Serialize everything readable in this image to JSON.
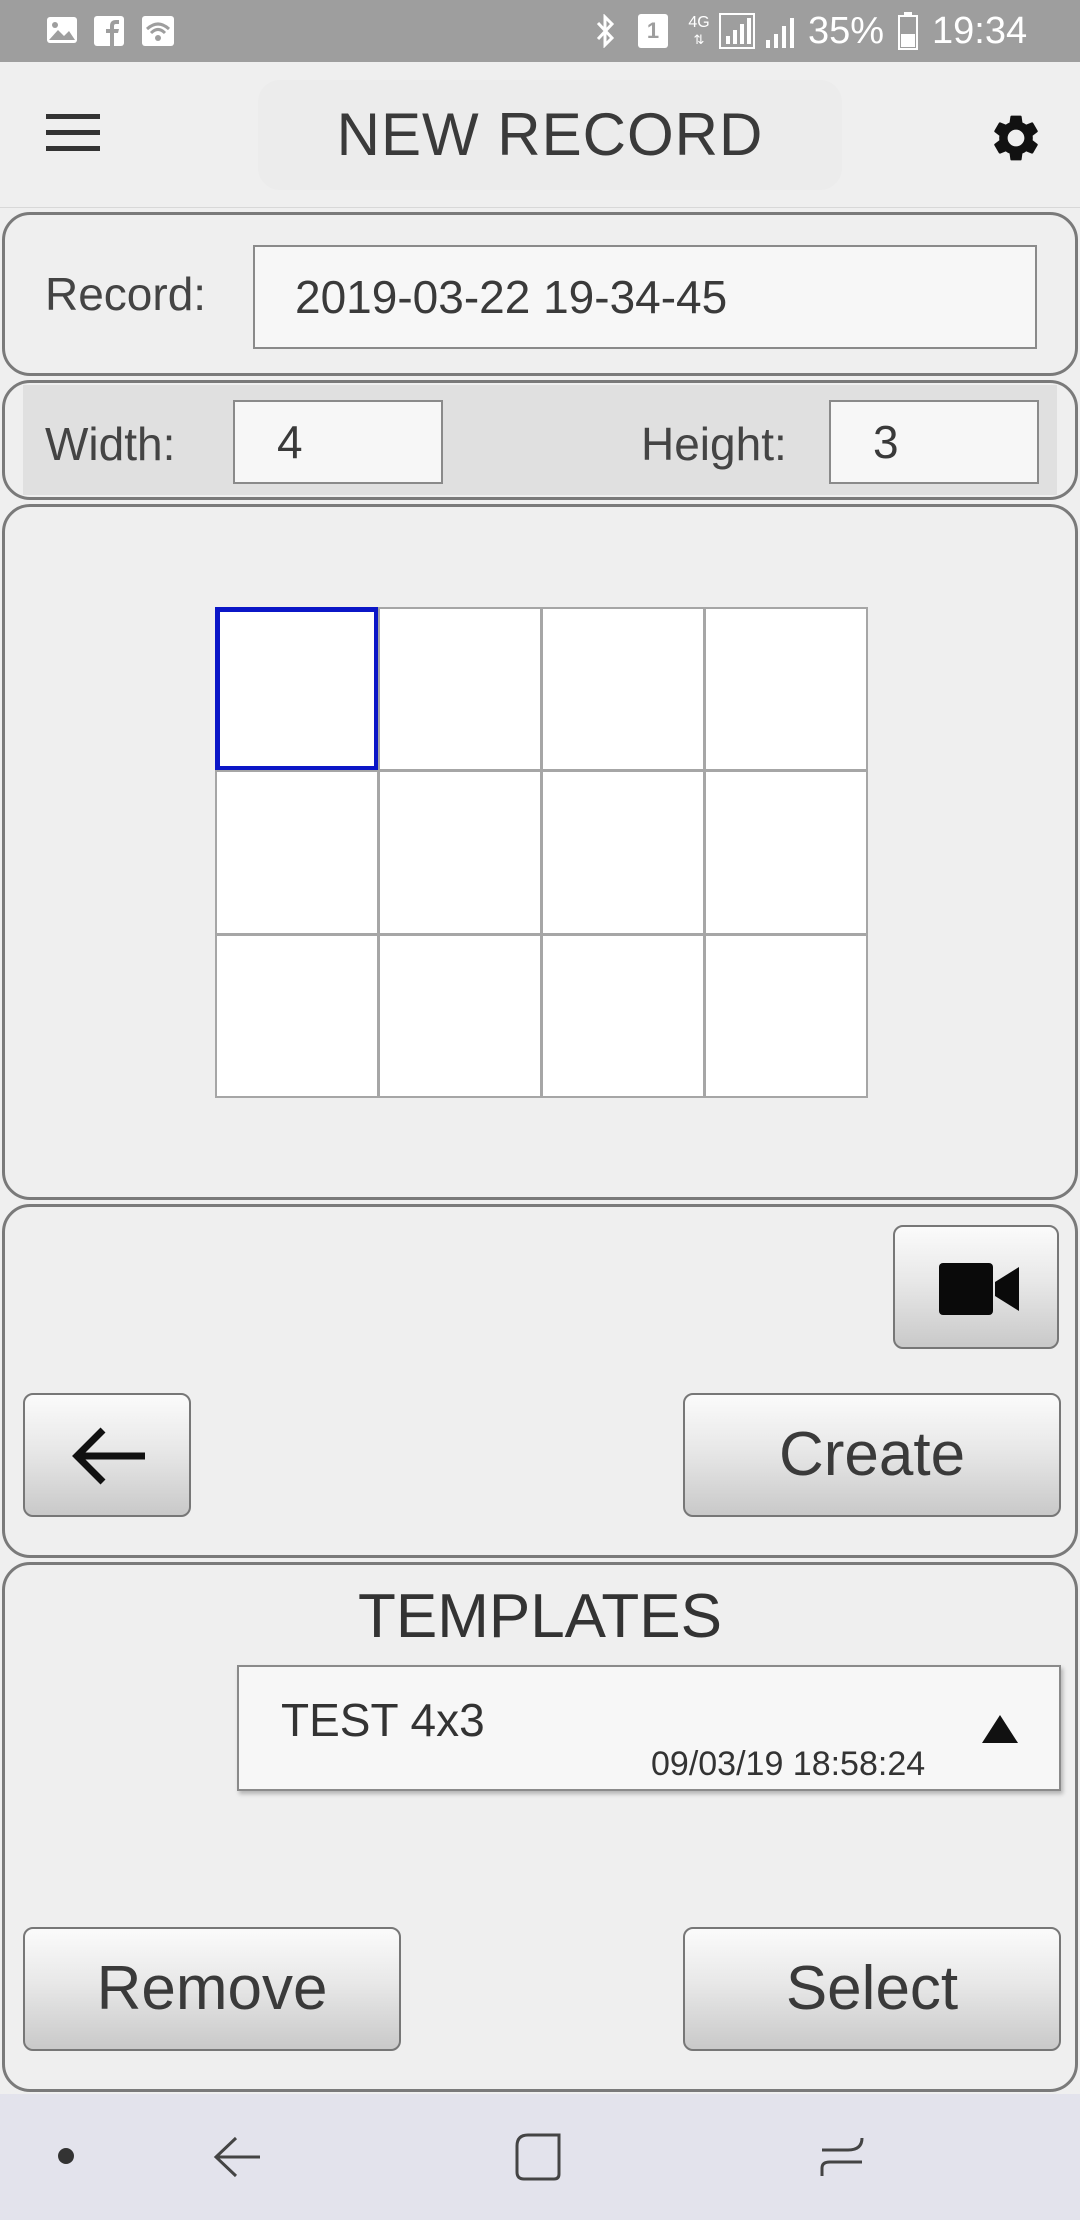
{
  "status_bar": {
    "battery_percent": "35%",
    "time": "19:34",
    "network": "4G",
    "sim_slot": "1",
    "icons": [
      "gallery-icon",
      "facebook-icon",
      "wifi-icon",
      "bluetooth-icon",
      "sim-icon",
      "network-icon",
      "signal-icon",
      "signal-icon-2",
      "battery-icon"
    ]
  },
  "app_bar": {
    "title": "NEW RECORD",
    "menu_icon": "hamburger-menu-icon",
    "settings_icon": "gear-icon"
  },
  "record": {
    "label": "Record:",
    "value": "2019-03-22 19-34-45"
  },
  "dimensions": {
    "width_label": "Width:",
    "width_value": "4",
    "height_label": "Height:",
    "height_value": "3"
  },
  "grid": {
    "columns": 4,
    "rows": 3,
    "selected_cell": [
      0,
      0
    ],
    "selected_color": "#0b16c7"
  },
  "actions": {
    "camera_icon": "video-camera-icon",
    "back_icon": "arrow-left-icon",
    "create_label": "Create"
  },
  "templates": {
    "title": "TEMPLATES",
    "selected": {
      "name": "TEST 4x3",
      "timestamp": "09/03/19 18:58:24"
    },
    "dropdown_icon": "triangle-up-icon",
    "remove_label": "Remove",
    "select_label": "Select"
  },
  "nav_bar": {
    "icons": [
      "dot-icon",
      "back-icon",
      "home-icon",
      "recents-icon"
    ]
  }
}
